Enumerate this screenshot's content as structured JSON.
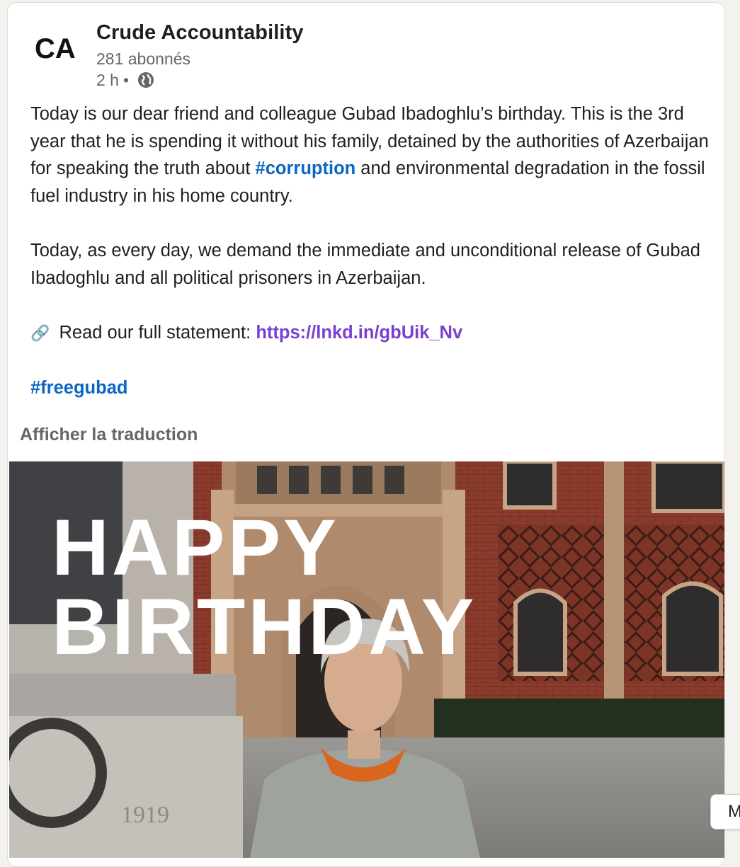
{
  "post": {
    "author": {
      "name": "Crude Accountability",
      "logo_text": "CA",
      "followers": "281 abonnés"
    },
    "meta": {
      "time": "2 h",
      "separator": "•",
      "visibility_icon": "globe-icon"
    },
    "body": {
      "p1_text": "Today is our dear friend and colleague Gubad Ibadoghlu’s birthday. This is the 3rd year that he is spending it without his family, detained by the authorities of Azerbaijan for speaking the truth about ",
      "p1_hashtag": "#corruption",
      "p1_text_end": " and environmental degradation in the fossil fuel industry in his home country.",
      "p2": "Today, as every day, we demand the immediate and unconditional release of Gubad Ibadoghlu and all political prisoners in Azerbaijan.",
      "p3_icon": "🔗",
      "p3_label": " Read our full statement: ",
      "p3_link": "https://lnkd.in/gbUik_Nv",
      "p4_hashtag": "#freegubad"
    },
    "translate_label": "Afficher la traduction",
    "image": {
      "headline_line1": "HAPPY",
      "headline_line2": "BIRTHDAY",
      "monument_year": "1919"
    }
  },
  "side_tab": {
    "label": "M"
  },
  "colors": {
    "hashtag": "#0a66c2",
    "link": "#7b3fd1",
    "text": "#1f1f1f",
    "muted": "#666666",
    "brick": "#8a3b2c"
  }
}
